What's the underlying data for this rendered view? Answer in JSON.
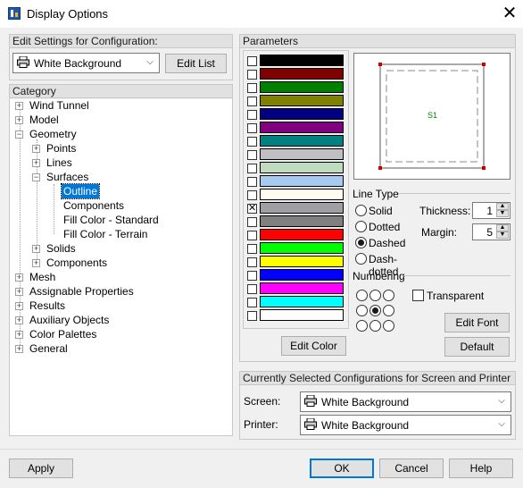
{
  "window": {
    "title": "Display Options",
    "close_glyph": "✕"
  },
  "edit_settings": {
    "header": "Edit Settings for Configuration:",
    "selected": "White Background",
    "edit_list_label": "Edit List"
  },
  "category": {
    "header": "Category",
    "items": [
      {
        "label": "Wind Tunnel",
        "expander": "+"
      },
      {
        "label": "Model",
        "expander": "+"
      },
      {
        "label": "Geometry",
        "expander": "−"
      },
      {
        "label": "Points",
        "expander": "+"
      },
      {
        "label": "Lines",
        "expander": "+"
      },
      {
        "label": "Surfaces",
        "expander": "−"
      },
      {
        "label": "Outline"
      },
      {
        "label": "Components"
      },
      {
        "label": "Fill Color - Standard"
      },
      {
        "label": "Fill Color - Terrain"
      },
      {
        "label": "Solids",
        "expander": "+"
      },
      {
        "label": "Components",
        "expander": "+"
      },
      {
        "label": "Mesh",
        "expander": "+"
      },
      {
        "label": "Assignable Properties",
        "expander": "+"
      },
      {
        "label": "Results",
        "expander": "+"
      },
      {
        "label": "Auxiliary Objects",
        "expander": "+"
      },
      {
        "label": "Color Palettes",
        "expander": "+"
      },
      {
        "label": "General",
        "expander": "+"
      }
    ]
  },
  "parameters": {
    "header": "Parameters",
    "swatches": [
      {
        "color": "#000000",
        "checked": false
      },
      {
        "color": "#800000",
        "checked": false
      },
      {
        "color": "#008000",
        "checked": false
      },
      {
        "color": "#808000",
        "checked": false
      },
      {
        "color": "#000080",
        "checked": false
      },
      {
        "color": "#800080",
        "checked": false
      },
      {
        "color": "#008080",
        "checked": false
      },
      {
        "color": "#c0c0c0",
        "checked": false
      },
      {
        "color": "#c0dcc0",
        "checked": false
      },
      {
        "color": "#a6caf0",
        "checked": false
      },
      {
        "color": "#fffbf0",
        "checked": false
      },
      {
        "color": "#a0a0a4",
        "checked": true
      },
      {
        "color": "#808080",
        "checked": false
      },
      {
        "color": "#ff0000",
        "checked": false
      },
      {
        "color": "#00ff00",
        "checked": false
      },
      {
        "color": "#ffff00",
        "checked": false
      },
      {
        "color": "#0000ff",
        "checked": false
      },
      {
        "color": "#ff00ff",
        "checked": false
      },
      {
        "color": "#00ffff",
        "checked": false
      },
      {
        "color": "#ffffff",
        "checked": false
      }
    ],
    "edit_color_label": "Edit Color",
    "preview_label": "S1",
    "line_type": {
      "label": "Line Type",
      "options": [
        "Solid",
        "Dotted",
        "Dashed",
        "Dash-dotted"
      ],
      "selected": "Dashed"
    },
    "thickness_label": "Thickness:",
    "thickness_value": "1",
    "margin_label": "Margin:",
    "margin_value": "5",
    "numbering_label": "Numbering",
    "numbering_selected": "center",
    "transparent_label": "Transparent",
    "edit_font_label": "Edit Font",
    "default_label": "Default"
  },
  "current_configs": {
    "header": "Currently Selected Configurations for Screen and Printer",
    "screen_label": "Screen:",
    "screen_value": "White Background",
    "printer_label": "Printer:",
    "printer_value": "White Background"
  },
  "footer": {
    "apply": "Apply",
    "ok": "OK",
    "cancel": "Cancel",
    "help": "Help"
  },
  "colors": {
    "selection": "#0078d7",
    "preview_corner": "#c00000",
    "preview_label": "#008000"
  }
}
